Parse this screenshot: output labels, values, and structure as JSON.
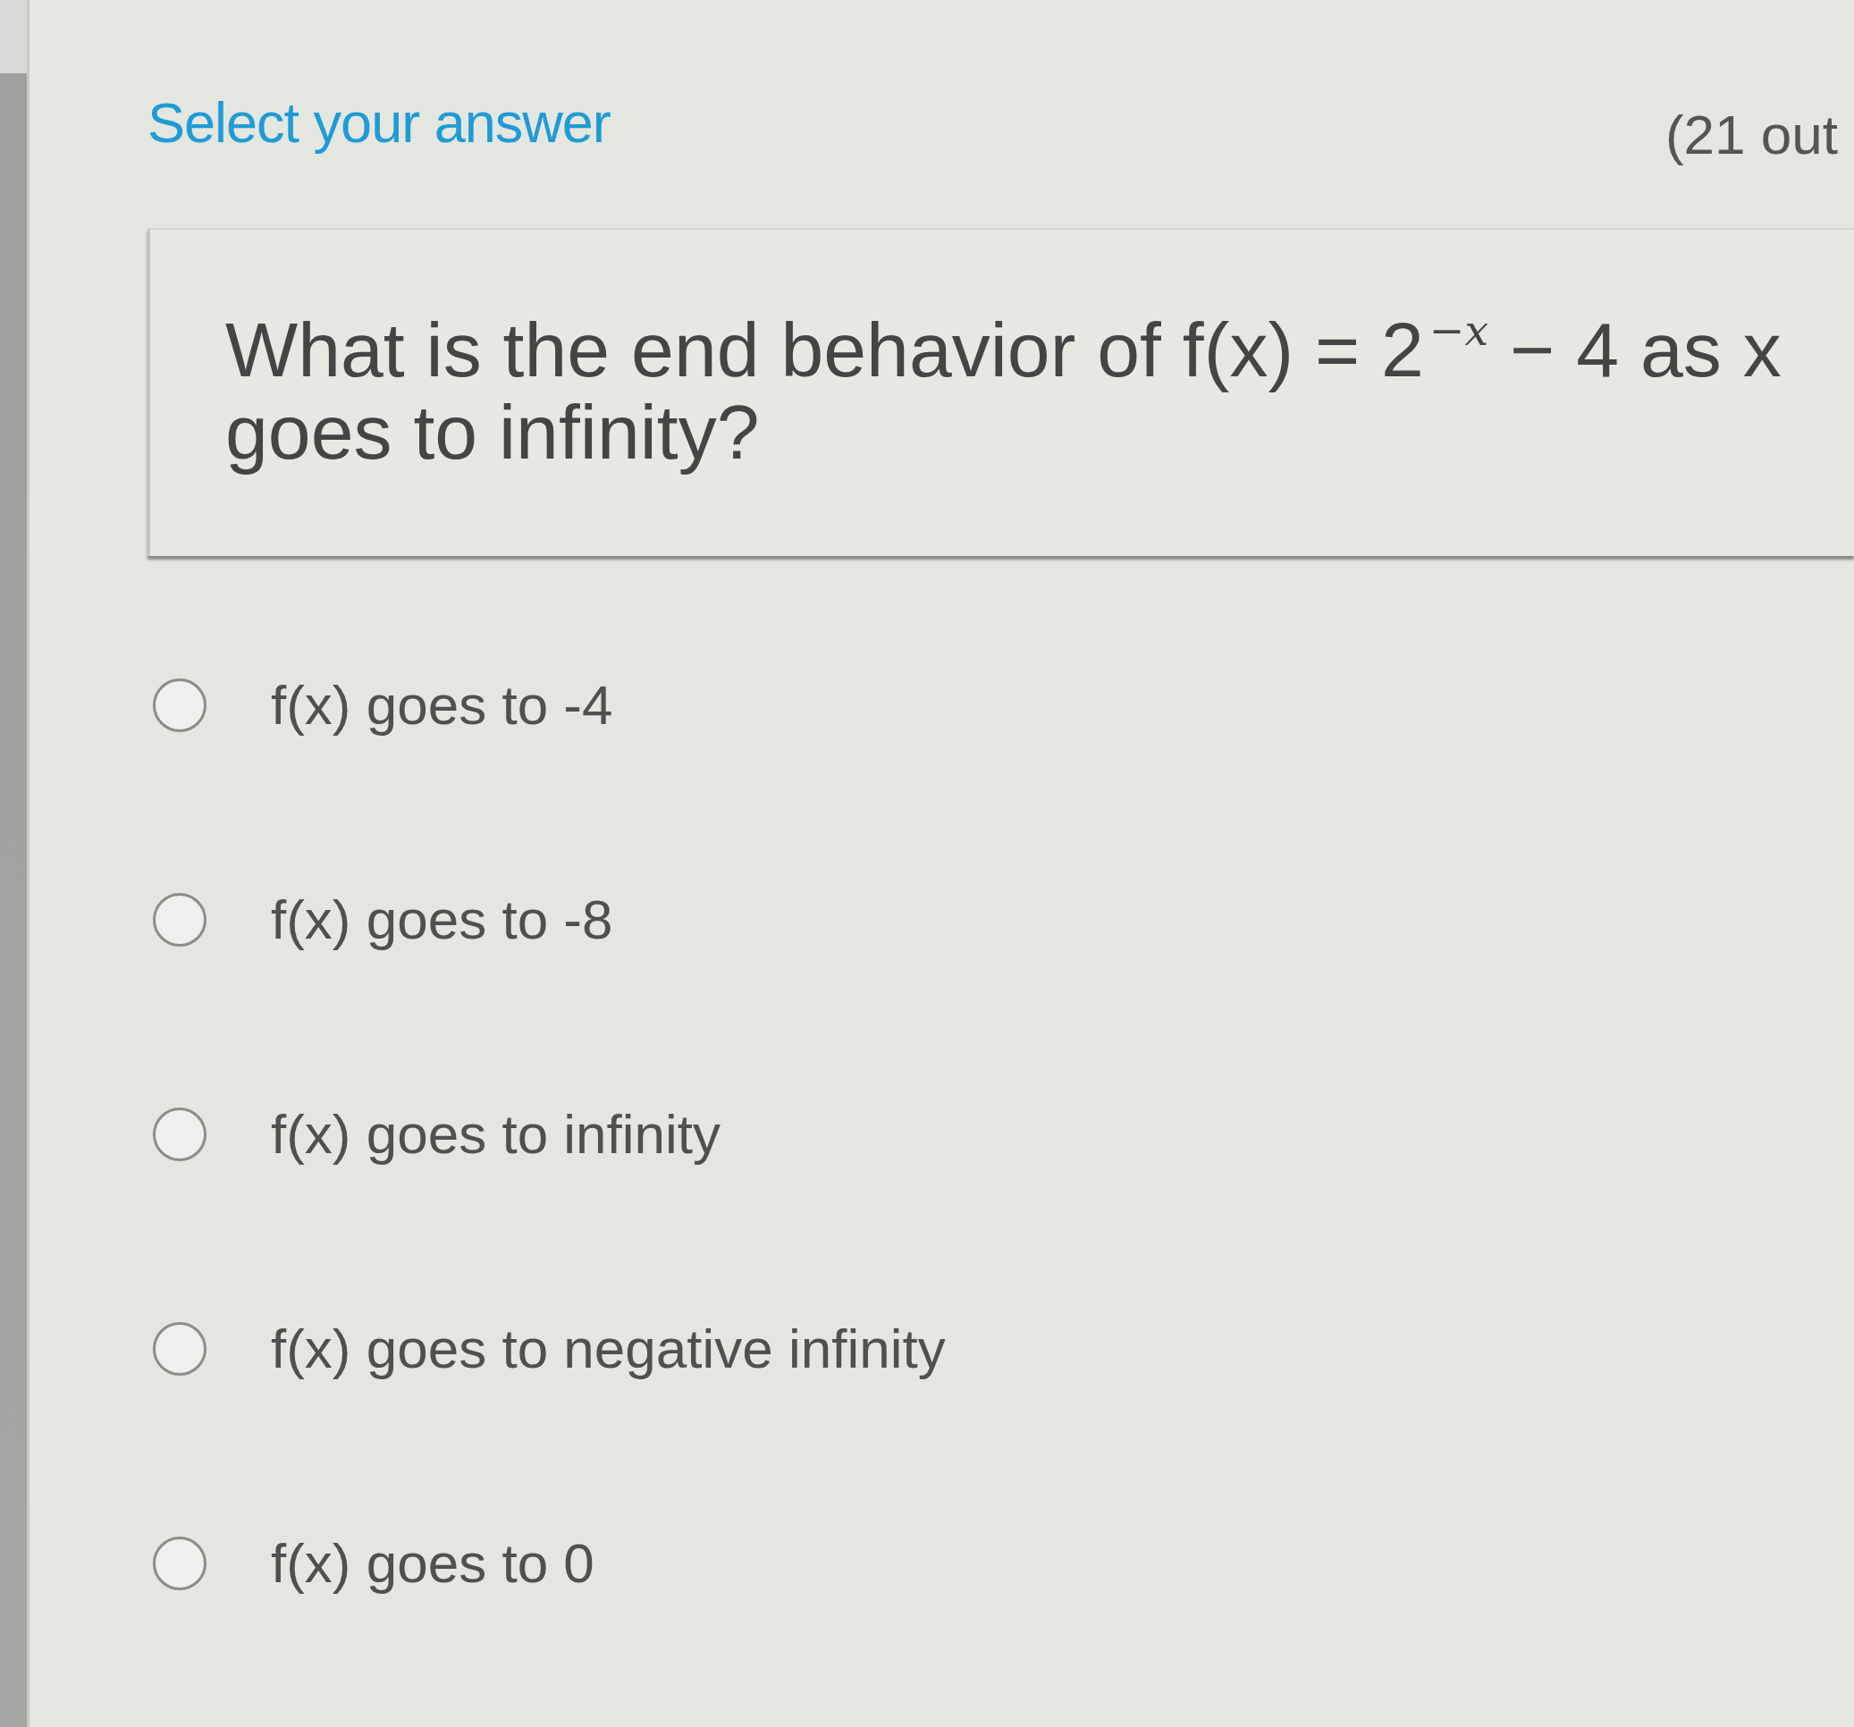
{
  "header": {
    "title": "Select your answer",
    "score": "(21 out"
  },
  "question": {
    "text": "What is the end behavior of f(x) = 2$^{−x}$ − 4 as x goes to infinity?"
  },
  "options": [
    {
      "label": "f(x) goes to -4",
      "selected": false
    },
    {
      "label": "f(x) goes to -8",
      "selected": false
    },
    {
      "label": "f(x) goes to infinity",
      "selected": false
    },
    {
      "label": "f(x) goes to negative infinity",
      "selected": false
    },
    {
      "label": "f(x) goes to 0",
      "selected": false
    }
  ]
}
